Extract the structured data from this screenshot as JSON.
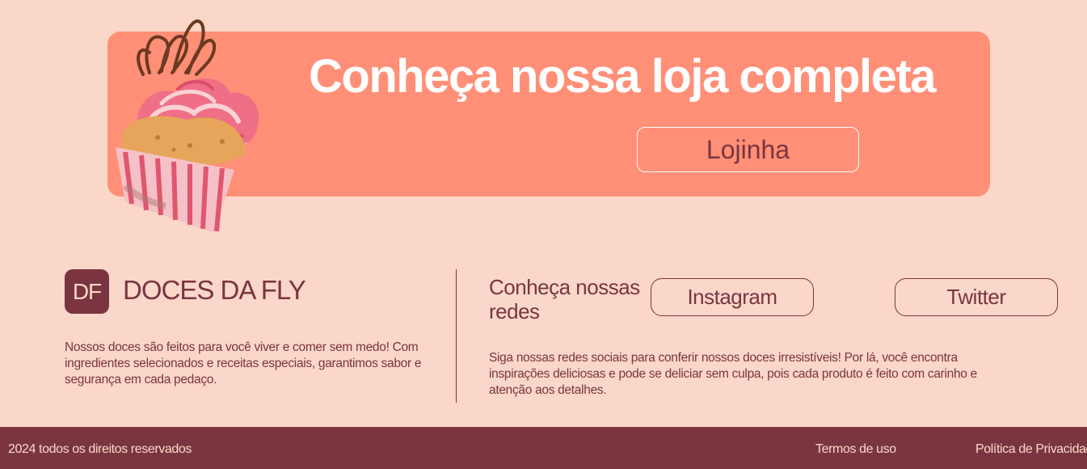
{
  "banner": {
    "title": "Conheça nossa loja completa",
    "button_label": "Lojinha"
  },
  "brand": {
    "logo_text": "DF",
    "name": "DOCES DA FLY",
    "description": "Nossos doces são feitos para você viver e comer sem medo! Com ingredientes selecionados e receitas especiais, garantimos sabor e segurança em cada pedaço."
  },
  "social": {
    "heading": "Conheça nossas redes",
    "instagram_label": "Instagram",
    "twitter_label": "Twitter",
    "description": "Siga nossas redes sociais para conferir nossos doces irresistíveis! Por lá, você encontra inspirações deliciosas e pode se deliciar sem culpa, pois cada produto é feito com carinho e atenção aos detalhes."
  },
  "footer": {
    "copyright": "2024 todos os direitos reservados",
    "terms": "Termos de uso",
    "privacy": "Política de Privacidade"
  },
  "colors": {
    "background": "#fad7c8",
    "banner": "#ff8f76",
    "primary": "#7a3540",
    "white": "#ffffff"
  },
  "icons": {
    "cupcake": "cupcake-illustration"
  }
}
